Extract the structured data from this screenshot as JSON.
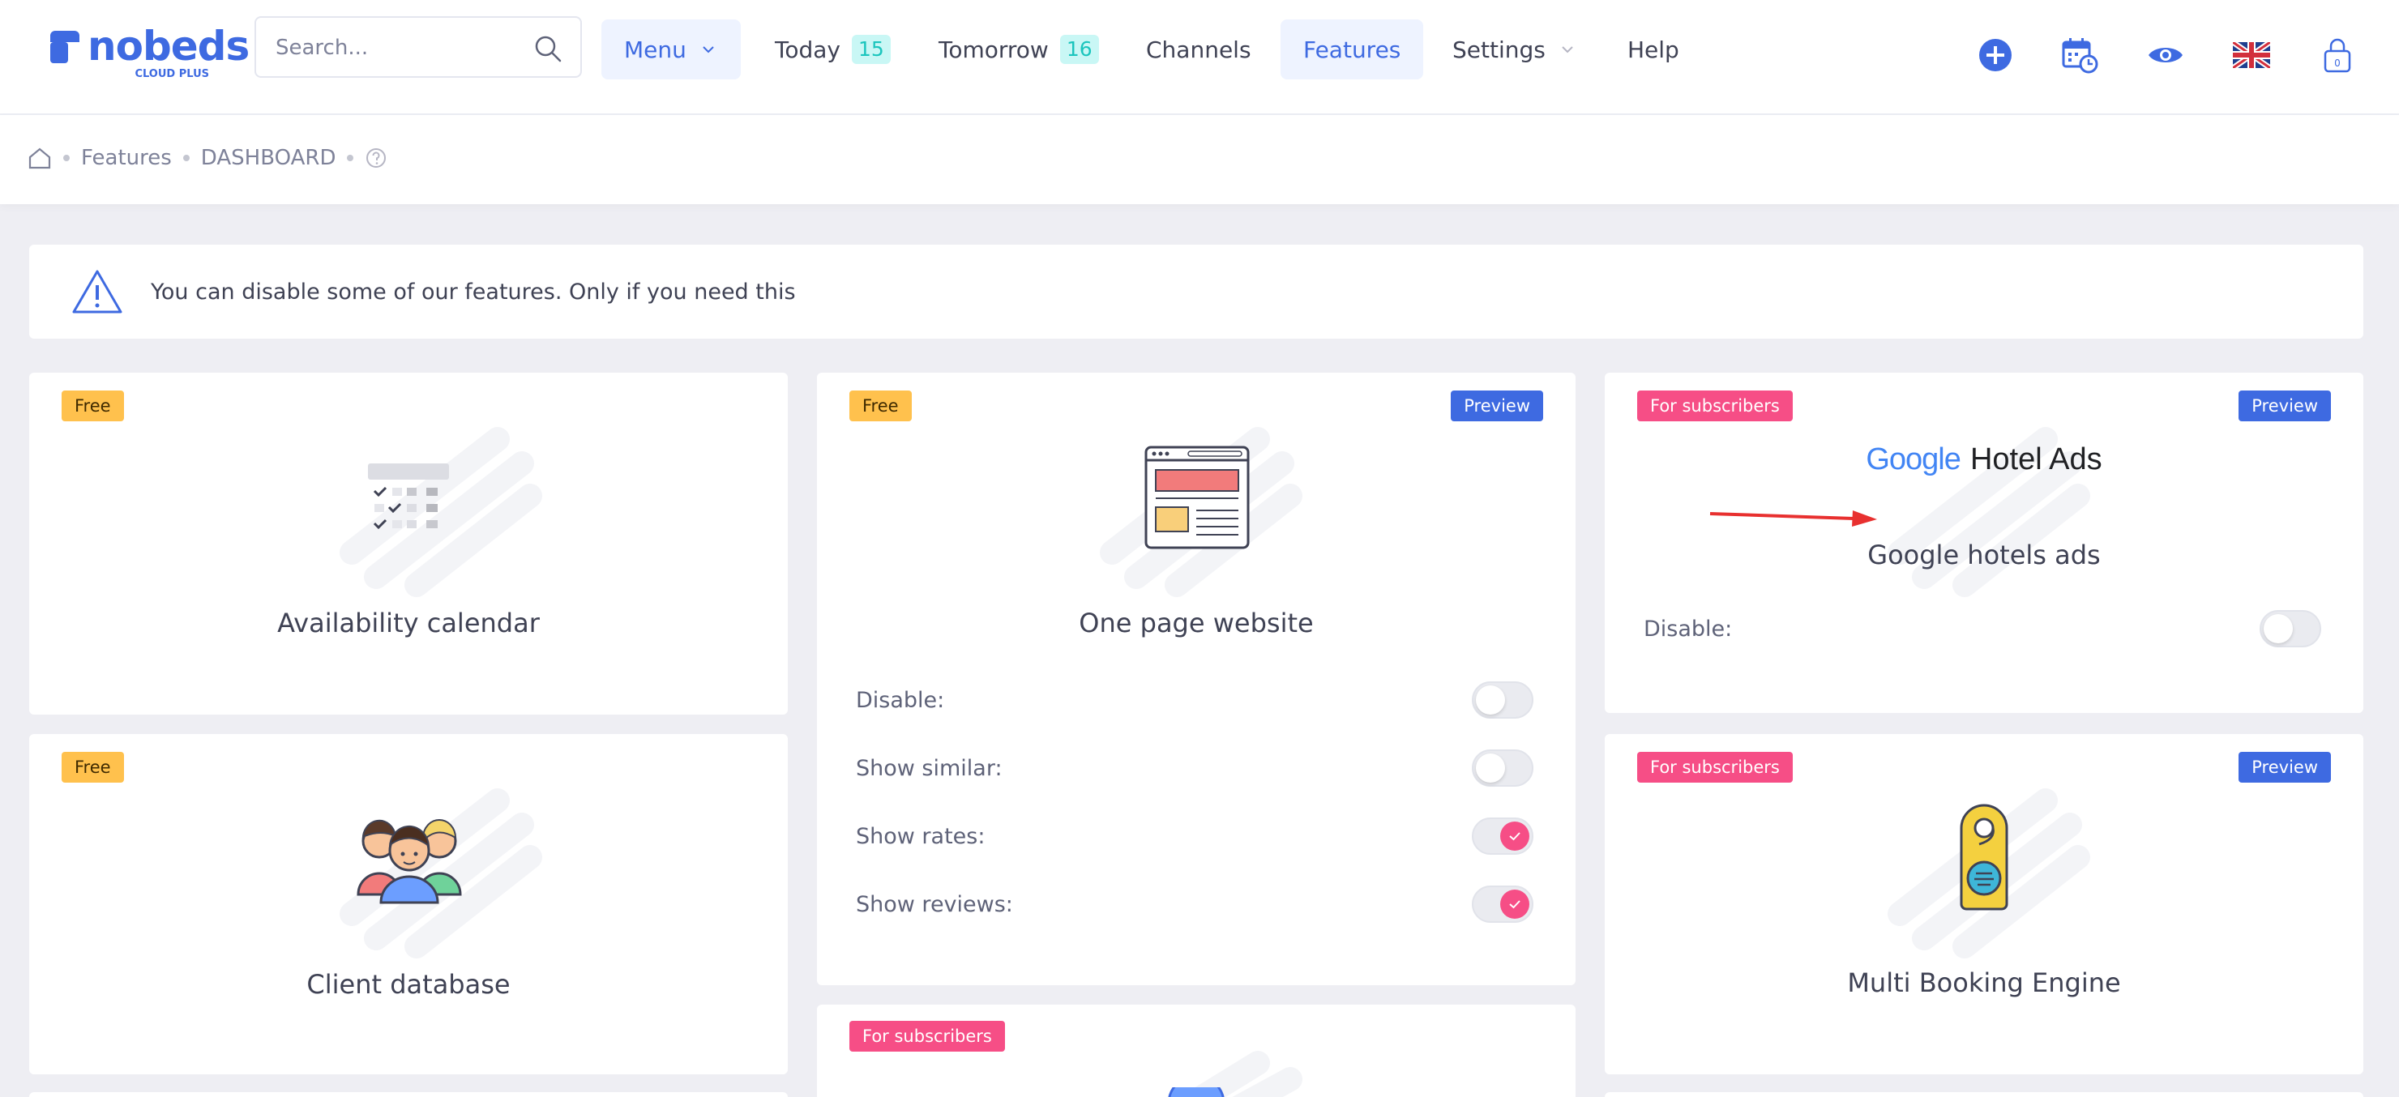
{
  "brand": {
    "name": "nobeds",
    "sub": "CLOUD PLUS"
  },
  "search": {
    "placeholder": "Search..."
  },
  "nav": {
    "menu": "Menu",
    "today": "Today",
    "today_count": "15",
    "tomorrow": "Tomorrow",
    "tomorrow_count": "16",
    "channels": "Channels",
    "features": "Features",
    "settings": "Settings",
    "help": "Help"
  },
  "header_icons": [
    "plus-circle-icon",
    "calendar-clock-icon",
    "eye-icon",
    "uk-flag-icon",
    "lock-icon"
  ],
  "lock_count": "0",
  "breadcrumb": {
    "features": "Features",
    "dashboard": "DASHBOARD"
  },
  "notice": {
    "text": "You can disable some of our features. Only if you need this"
  },
  "labels": {
    "free": "Free",
    "subscribers": "For subscribers",
    "preview": "Preview",
    "disable": "Disable:",
    "show_similar": "Show similar:",
    "show_rates": "Show rates:",
    "show_reviews": "Show reviews:"
  },
  "cards": {
    "availability": {
      "title": "Availability calendar"
    },
    "website": {
      "title": "One page website",
      "options": {
        "disable": false,
        "show_similar": false,
        "show_rates": true,
        "show_reviews": true
      }
    },
    "google": {
      "logo_google": "Google",
      "logo_rest": "Hotel Ads",
      "title": "Google hotels ads",
      "disable": false
    },
    "clients": {
      "title": "Client database"
    },
    "multi": {
      "title": "Multi Booking Engine"
    }
  },
  "colors": {
    "accent": "#3e6ae1",
    "free": "#ffc14d",
    "subscribers": "#f64e86",
    "teal": "#1bc5bd"
  }
}
